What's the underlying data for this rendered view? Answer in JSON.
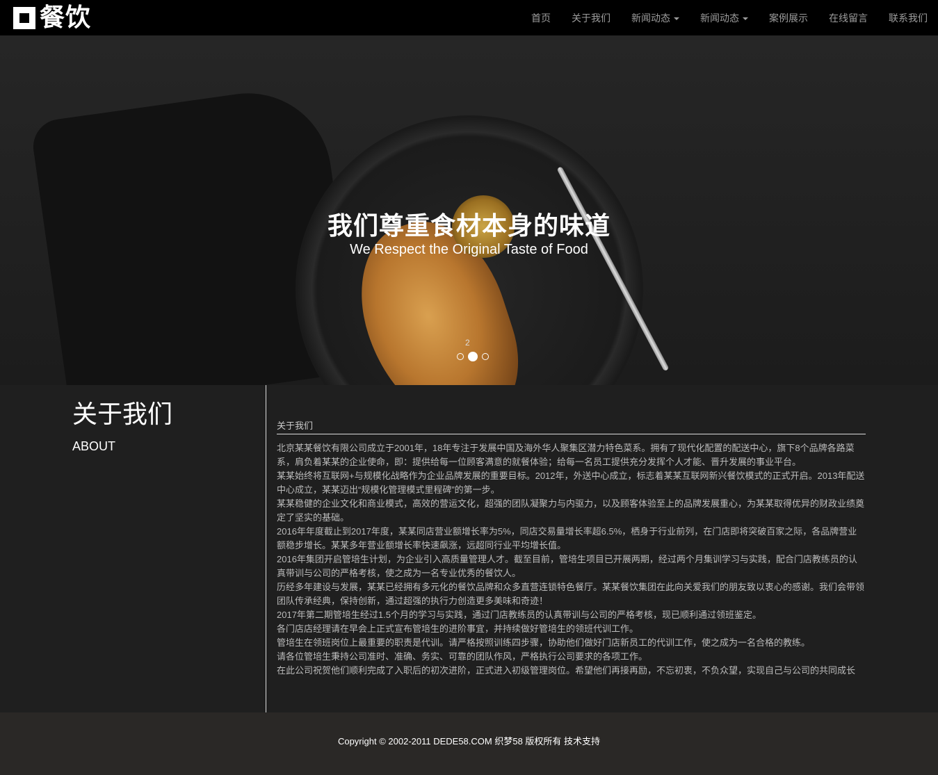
{
  "header": {
    "logo_text": "餐饮",
    "nav": [
      {
        "label": "首页",
        "has_dropdown": false
      },
      {
        "label": "关于我们",
        "has_dropdown": false
      },
      {
        "label": "新闻动态",
        "has_dropdown": true
      },
      {
        "label": "新闻动态",
        "has_dropdown": true
      },
      {
        "label": "案例展示",
        "has_dropdown": false
      },
      {
        "label": "在线留言",
        "has_dropdown": false
      },
      {
        "label": "联系我们",
        "has_dropdown": false
      }
    ]
  },
  "banner": {
    "title": "我们尊重食材本身的味道",
    "subtitle": "We Respect the Original Taste of Food",
    "slide_number": "2",
    "slides_count": 3,
    "active_slide": 2
  },
  "about": {
    "heading": "关于我们",
    "subheading": "ABOUT",
    "breadcrumb": "关于我们",
    "paragraphs": [
      "北京某某餐饮有限公司成立于2001年，18年专注于发展中国及海外华人聚集区潜力特色菜系。拥有了现代化配置的配送中心，旗下8个品牌各路菜系，肩负着某某的企业使命，即：提供给每一位顾客满意的就餐体验；给每一名员工提供充分发挥个人才能、晋升发展的事业平台。",
      "某某始终将互联网+与规模化战略作为企业品牌发展的重要目标。2012年，外送中心成立，标志着某某互联网新兴餐饮模式的正式开启。2013年配送中心成立，某某迈出“规模化管理模式里程碑”的第一步。",
      "某某稳健的企业文化和商业模式，高效的营运文化，超强的团队凝聚力与内驱力，以及顾客体验至上的品牌发展重心，为某某取得优异的财政业绩奠定了坚实的基础。",
      "2016年年度截止到2017年度，某某同店营业额增长率为5%，同店交易量增长率超6.5%，栖身于行业前列，在门店即将突破百家之际，各品牌营业额稳步增长。某某多年营业额增长率快速飙涨，远超同行业平均增长值。",
      "2016年集团开启管培生计划，为企业引入高质量管理人才。截至目前，管培生项目已开展两期，经过两个月集训学习与实践，配合门店教练员的认真带训与公司的严格考核，使之成为一名专业优秀的餐饮人。",
      "历经多年建设与发展，某某已经拥有多元化的餐饮品牌和众多直营连锁特色餐厅。某某餐饮集团在此向关爱我们的朋友致以衷心的感谢。我们会带领团队传承经典，保持创新，通过超强的执行力创造更多美味和奇迹！",
      "2017年第二期管培生经过1.5个月的学习与实践，通过门店教练员的认真带训与公司的严格考核，现已顺利通过领班鉴定。",
      "各门店店经理请在早会上正式宣布管培生的进阶事宜，并持续做好管培生的领班代训工作。",
      "管培生在领班岗位上最重要的职责是代训。请严格按照训练四步骤，协助他们做好门店新员工的代训工作，使之成为一名合格的教练。",
      "请各位管培生秉持公司准时、准确、务实、可靠的团队作风，严格执行公司要求的各项工作。",
      "在此公司祝贺他们顺利完成了入职后的初次进阶，正式进入初级管理岗位。希望他们再接再励，不忘初衷，不负众望，实现自己与公司的共同成长"
    ]
  },
  "footer": {
    "copyright": "Copyright © 2002-2011 DEDE58.COM 织梦58 版权所有 技术支持"
  }
}
